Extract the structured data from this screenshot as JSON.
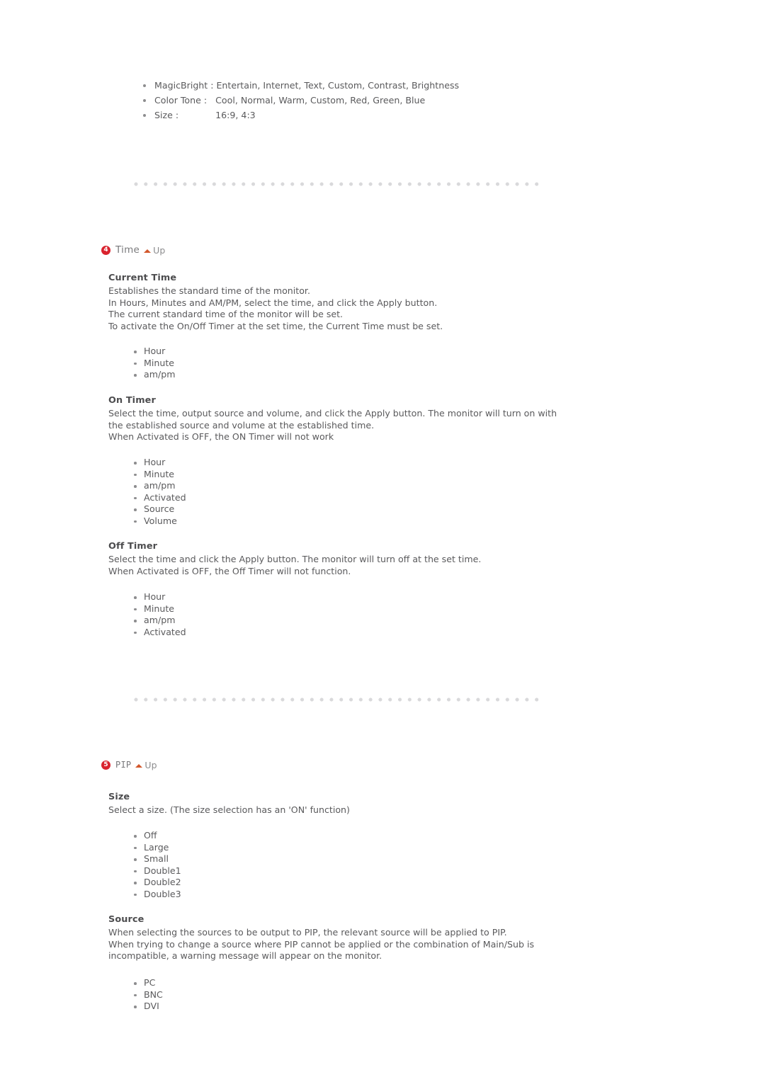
{
  "top_features": [
    "MagicBright : Entertain, Internet, Text, Custom, Contrast, Brightness",
    "Color Tone :   Cool, Normal, Warm, Custom, Red, Green, Blue",
    "Size :             16:9, 4:3"
  ],
  "colors": {
    "badge_red": "#d9232e",
    "up_arrow": "#d2572b",
    "body_text": "#5a5a5c",
    "heading_text": "#4c4c4e",
    "dot_rule": "#d9d9db"
  },
  "sections": [
    {
      "number": "4",
      "title": "Time",
      "up_label": "Up",
      "blocks": [
        {
          "heading": "Current Time",
          "paragraphs": [
            "Establishes the standard time of the monitor.",
            "In Hours, Minutes and AM/PM, select the time, and click the Apply button.",
            "The current standard time of the monitor will be set.",
            "To activate the On/Off Timer at the set time, the Current Time must be set."
          ],
          "items": [
            "Hour",
            "Minute",
            "am/pm"
          ]
        },
        {
          "heading": "On Timer",
          "paragraphs": [
            "Select the time, output source and volume, and click the Apply button. The monitor will turn on with",
            "the established source and volume at the established time.",
            "When Activated is OFF, the ON Timer will not work"
          ],
          "items": [
            "Hour",
            "Minute",
            "am/pm",
            "Activated",
            "Source",
            "Volume"
          ]
        },
        {
          "heading": "Off Timer",
          "paragraphs": [
            "Select the time and click the Apply button. The monitor will turn off at the set time.",
            "When Activated is OFF, the Off Timer will not function."
          ],
          "items": [
            "Hour",
            "Minute",
            "am/pm",
            "Activated"
          ]
        }
      ]
    },
    {
      "number": "5",
      "title": "PIP",
      "up_label": "Up",
      "blocks": [
        {
          "heading": "Size",
          "paragraphs": [
            "Select a size. (The size selection has an 'ON' function)"
          ],
          "items": [
            "Off",
            "Large",
            "Small",
            "Double1",
            "Double2",
            "Double3"
          ]
        },
        {
          "heading": "Source",
          "paragraphs": [
            "When selecting the sources to be output to PIP, the relevant source will be applied to PIP.",
            "When trying to change a source where PIP cannot be applied or the combination of Main/Sub is",
            "incompatible, a warning message will appear on the monitor."
          ],
          "items": [
            "PC",
            "BNC",
            "DVI"
          ]
        }
      ]
    }
  ]
}
